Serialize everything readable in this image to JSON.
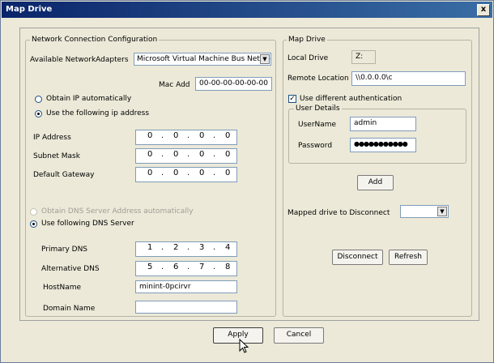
{
  "window": {
    "title": "Map Drive",
    "close": "x"
  },
  "network": {
    "legend": "Network Connection Configuration",
    "adapters_label": "Available NetworkAdapters",
    "adapter_value": "Microsoft Virtual Machine Bus Networl",
    "mac_label": "Mac Add",
    "mac_value": "00-00-00-00-00-00",
    "obtain_ip_auto": "Obtain IP automatically",
    "use_following_ip": "Use the following ip address",
    "ip_label": "IP Address",
    "subnet_label": "Subnet Mask",
    "gateway_label": "Default Gateway",
    "ip": [
      "0",
      "0",
      "0",
      "0"
    ],
    "subnet": [
      "0",
      "0",
      "0",
      "0"
    ],
    "gateway": [
      "0",
      "0",
      "0",
      "0"
    ],
    "obtain_dns_auto": "Obtain DNS Server Address automatically",
    "use_following_dns": "Use following DNS Server",
    "primary_dns_label": "Primary DNS",
    "alt_dns_label": "Alternative DNS",
    "primary_dns": [
      "1",
      "2",
      "3",
      "4"
    ],
    "alt_dns": [
      "5",
      "6",
      "7",
      "8"
    ],
    "hostname_label": "HostName",
    "hostname_value": "minint-0pcirvr",
    "domain_label": "Domain Name",
    "domain_value": ""
  },
  "mapdrive": {
    "legend": "Map Drive",
    "local_drive_label": "Local Drive",
    "local_drive_value": "Z:",
    "remote_label": "Remote Location",
    "remote_value": "\\\\0.0.0.0\\c",
    "diff_auth_label": "Use different authentication",
    "diff_auth_checked": "✓",
    "user_details_legend": "User Details",
    "username_label": "UserName",
    "username_value": "admin",
    "password_label": "Password",
    "password_value": "●●●●●●●●●●●",
    "add_label": "Add",
    "disconnect_drive_label": "Mapped drive to Disconnect",
    "disconnect_drive_value": "",
    "disconnect_label": "Disconnect",
    "refresh_label": "Refresh"
  },
  "footer": {
    "apply_label": "Apply",
    "cancel_label": "Cancel"
  },
  "icons": {
    "dropdown": "chevron-down-icon",
    "close": "close-icon",
    "cursor": "mouse-pointer-icon"
  }
}
